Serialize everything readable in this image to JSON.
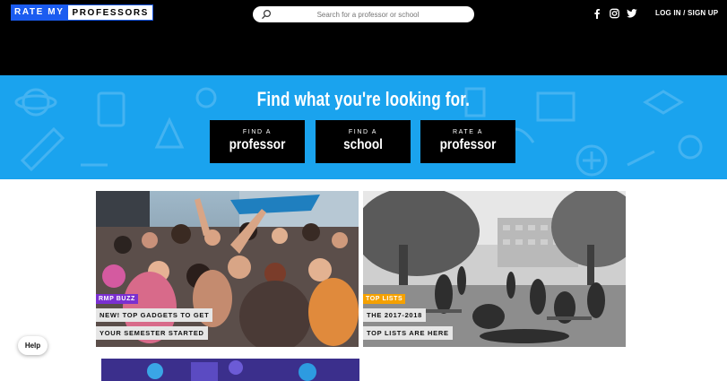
{
  "header": {
    "logo_left": "RATE MY",
    "logo_right": "PROFESSORS",
    "search_placeholder": "Search for a professor or school",
    "social": [
      "facebook-icon",
      "instagram-icon",
      "twitter-icon"
    ],
    "login_label": "LOG IN / SIGN UP"
  },
  "hero": {
    "title": "Find what you're looking for.",
    "buttons": [
      {
        "small": "FIND A",
        "big": "professor"
      },
      {
        "small": "FIND A",
        "big": "school"
      },
      {
        "small": "RATE A",
        "big": "professor"
      }
    ]
  },
  "cards": [
    {
      "tag": "RMP BUZZ",
      "lines": [
        "NEW! TOP GADGETS TO GET",
        "YOUR SEMESTER STARTED"
      ]
    },
    {
      "tag": "TOP LISTS",
      "lines": [
        "THE 2017-2018",
        "TOP LISTS ARE HERE"
      ]
    }
  ],
  "help_label": "Help",
  "colors": {
    "brand_blue": "#1b5cf0",
    "hero_blue": "#1aa3ee",
    "tag_purple": "#7a2fd0",
    "tag_orange": "#f5a100"
  }
}
